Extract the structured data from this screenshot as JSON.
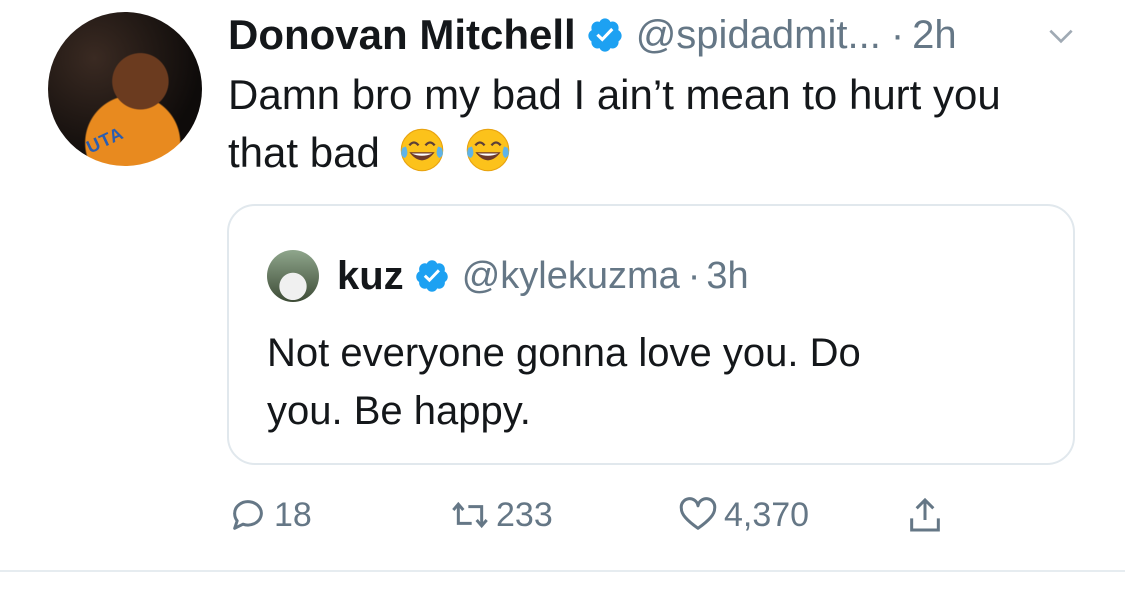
{
  "tweet": {
    "author_name": "Donovan Mitchell",
    "author_handle": "@spidadmit...",
    "time_sep": "·",
    "time": "2h",
    "text_line1": "Damn bro my bad I ain’t mean to hurt you",
    "text_line2": "that bad",
    "emoji": "😂",
    "avatar_jersey_text": "UTA"
  },
  "quote": {
    "author_name": "kuz",
    "author_handle": "@kylekuzma",
    "time_sep": "·",
    "time": "3h",
    "text_line1": "Not everyone gonna love you. Do",
    "text_line2": "you. Be happy."
  },
  "actions": {
    "replies": "18",
    "retweets": "233",
    "likes": "4,370"
  },
  "colors": {
    "accent": "#1da1f2",
    "muted": "#657786",
    "border": "#e1e8ed"
  }
}
